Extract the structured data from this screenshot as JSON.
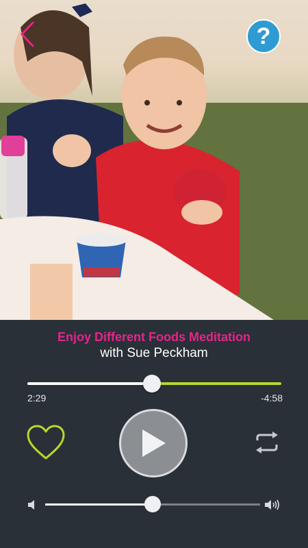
{
  "header": {
    "back_icon": "chevron-left-icon",
    "help_icon": "question-mark-icon",
    "help_label": "?"
  },
  "track": {
    "title": "Enjoy Different Foods Meditation",
    "subtitle": "with Sue Peckham",
    "elapsed": "2:29",
    "remaining": "-4:58",
    "progress_fraction": 0.49
  },
  "controls": {
    "favorite_icon": "heart-icon",
    "play_icon": "play-icon",
    "repeat_icon": "repeat-icon"
  },
  "volume": {
    "low_icon": "speaker-low-icon",
    "high_icon": "speaker-high-icon",
    "level_fraction": 0.5
  },
  "colors": {
    "title_accent": "#e5248a",
    "progress_remaining": "#b7d82b",
    "help_button": "#2e9bd3",
    "player_background": "#2a3038"
  }
}
